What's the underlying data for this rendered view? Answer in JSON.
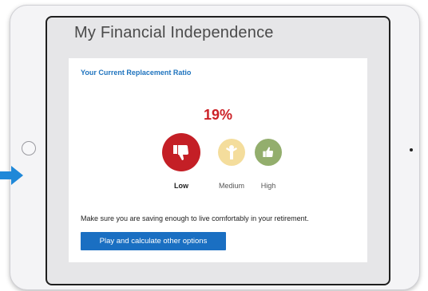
{
  "screen": {
    "title": "My Financial Independence"
  },
  "card": {
    "heading": "Your Current Replacement Ratio",
    "percent": "19%",
    "ratings": [
      {
        "label": "Low",
        "icon": "thumbs-down-icon",
        "color": "#c41f26",
        "selected": true
      },
      {
        "label": "Medium",
        "icon": "person-icon",
        "color": "#f4dd9c",
        "selected": false
      },
      {
        "label": "High",
        "icon": "thumbs-up-icon",
        "color": "#93ae6d",
        "selected": false
      }
    ],
    "message": "Make sure you are saving enough to live comfortably in your retirement.",
    "button_label": "Play and calculate other options"
  },
  "colors": {
    "accent": "#1e73be",
    "button": "#1a6fc2",
    "alert": "#cc2127"
  }
}
